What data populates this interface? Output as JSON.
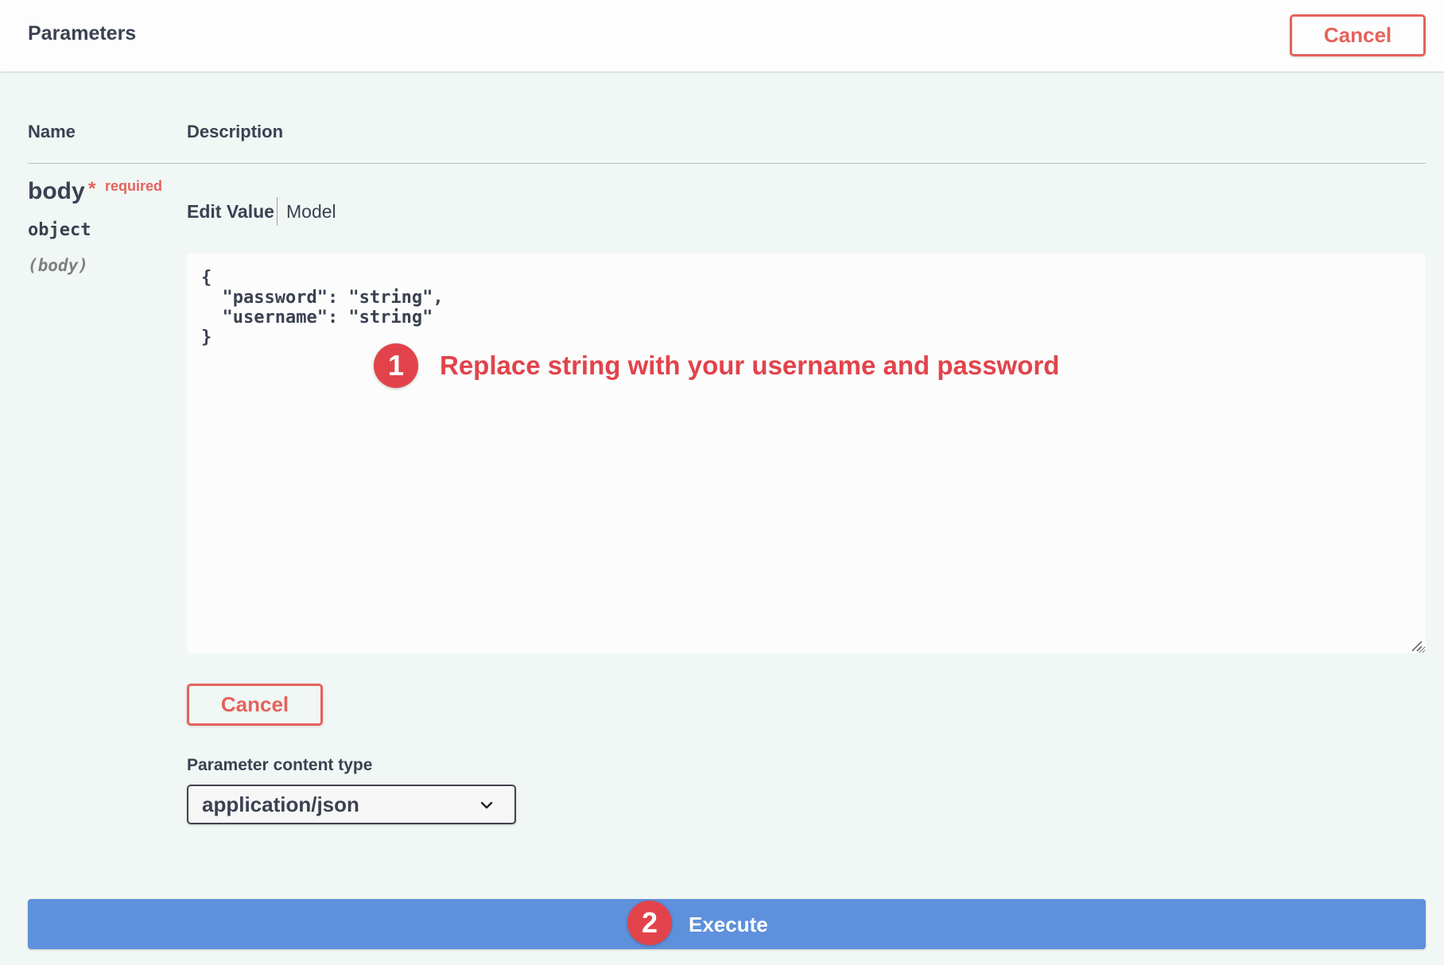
{
  "header": {
    "title": "Parameters",
    "cancel_label": "Cancel"
  },
  "table": {
    "col_name": "Name",
    "col_description": "Description"
  },
  "param": {
    "name": "body",
    "required_star": "*",
    "required_label": "required",
    "type": "object",
    "in": "(body)"
  },
  "tabs": {
    "edit_value": "Edit Value",
    "model": "Model"
  },
  "editor": {
    "value": "{\n  \"password\": \"string\",\n  \"username\": \"string\"\n}"
  },
  "annotations": {
    "step1_number": "1",
    "step1_text": "Replace string with your username and password",
    "step2_number": "2"
  },
  "cancel_label": "Cancel",
  "content_type": {
    "label": "Parameter content type",
    "selected": "application/json"
  },
  "execute_label": "Execute",
  "colors": {
    "accent_red": "#e5625c",
    "execute_blue": "#5e90db",
    "badge_red": "#e2434b"
  }
}
